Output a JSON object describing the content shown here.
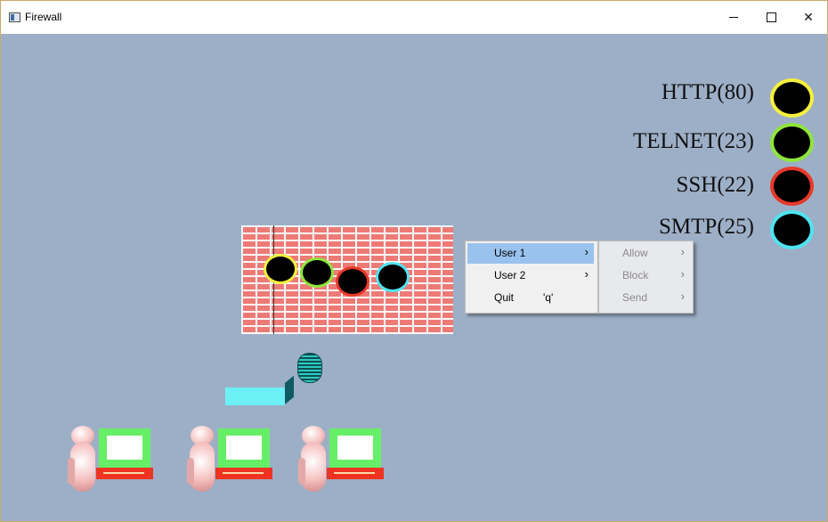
{
  "window": {
    "title": "Firewall",
    "border_color": "#c8a86a"
  },
  "title_buttons": {
    "minimize": "minimize-icon",
    "maximize": "maximize-icon",
    "close": "close-icon"
  },
  "scene": {
    "background": "#9dafc7",
    "wall_color": "#ee7a76"
  },
  "legend": [
    {
      "label": "HTTP(80)",
      "color": "#f5f03c"
    },
    {
      "label": "TELNET(23)",
      "color": "#8ee63a"
    },
    {
      "label": "SSH(22)",
      "color": "#e8392a"
    },
    {
      "label": "SMTP(25)",
      "color": "#4fe4f0"
    }
  ],
  "context_menu": {
    "items": [
      {
        "label": "User 1",
        "shortcut": "",
        "arrow": "›",
        "selected": true
      },
      {
        "label": "User 2",
        "shortcut": "",
        "arrow": "›",
        "selected": false
      },
      {
        "label": "Quit",
        "shortcut": "'q'",
        "arrow": "",
        "selected": false
      }
    ],
    "submenu": [
      {
        "label": "Allow",
        "arrow": "›"
      },
      {
        "label": "Block",
        "arrow": "›"
      },
      {
        "label": "Send",
        "arrow": "›"
      }
    ]
  }
}
